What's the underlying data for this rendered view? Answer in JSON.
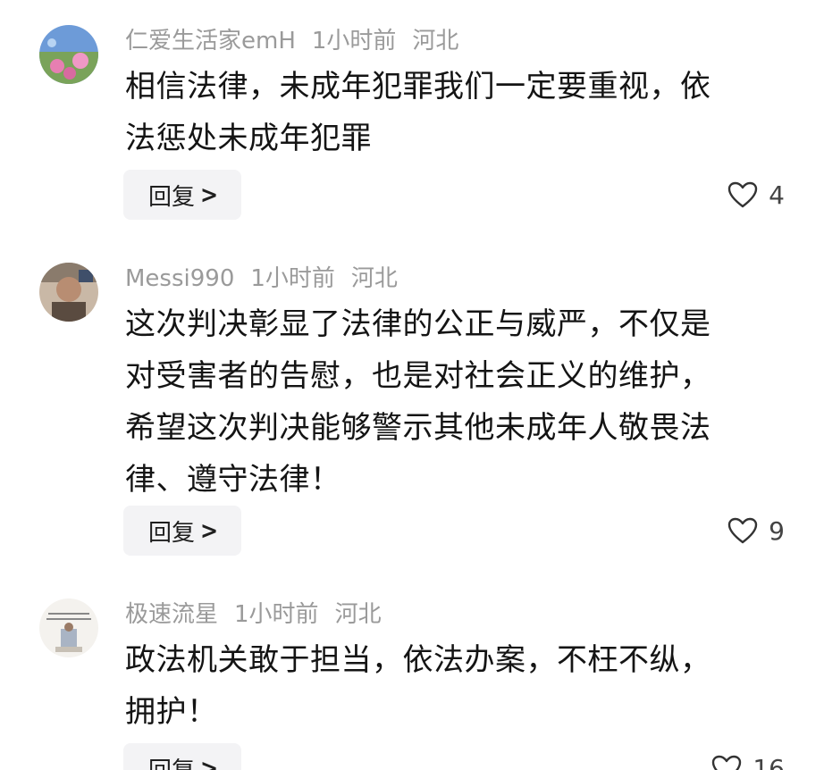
{
  "comments": [
    {
      "username": "仁爱生活家emH",
      "time": "1小时前",
      "location": "河北",
      "lines": [
        "相信法律，未成年犯罪我们一定要重视，依",
        "法惩处未成年犯罪"
      ],
      "reply_label": "回复",
      "likes": "4"
    },
    {
      "username": "Messi990",
      "time": "1小时前",
      "location": "河北",
      "lines": [
        "这次判决彰显了法律的公正与威严，不仅是",
        "对受害者的告慰，也是对社会正义的维护，",
        "希望这次判决能够警示其他未成年人敬畏法",
        "律、遵守法律！"
      ],
      "reply_label": "回复",
      "likes": "9"
    },
    {
      "username": "极速流星",
      "time": "1小时前",
      "location": "河北",
      "lines": [
        "政法机关敢于担当，依法办案，不枉不纵，",
        "拥护！"
      ],
      "reply_label": "回复",
      "likes": "16"
    }
  ],
  "icons": {
    "reply_chevron": "chevron-right-icon",
    "like": "heart-outline-icon"
  },
  "colors": {
    "meta_text": "#9a9a9a",
    "body_text": "#141414",
    "reply_bg": "#f3f3f5"
  }
}
